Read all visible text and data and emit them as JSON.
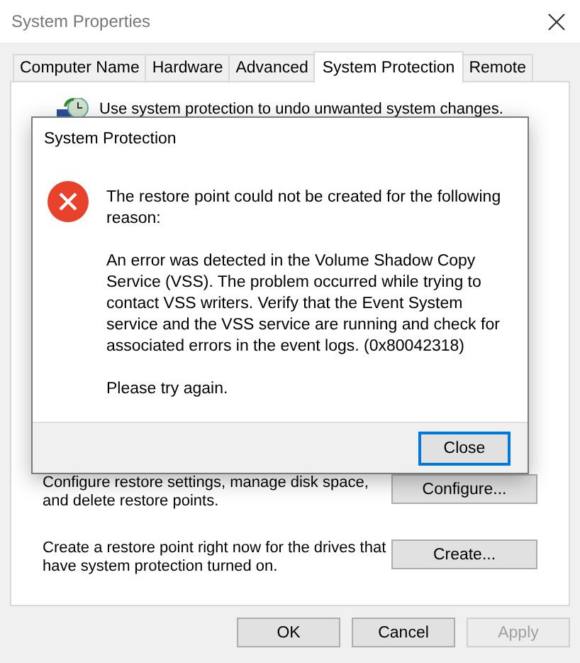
{
  "window": {
    "title": "System Properties"
  },
  "tabs": [
    {
      "label": "Computer Name",
      "selected": false
    },
    {
      "label": "Hardware",
      "selected": false
    },
    {
      "label": "Advanced",
      "selected": false
    },
    {
      "label": "System Protection",
      "selected": true
    },
    {
      "label": "Remote",
      "selected": false
    }
  ],
  "panel": {
    "intro": "Use system protection to undo unwanted system changes.",
    "actions": [
      {
        "description": "Configure restore settings, manage disk space, and delete restore points.",
        "button": "Configure..."
      },
      {
        "description": "Create a restore point right now for the drives that have system protection turned on.",
        "button": "Create..."
      }
    ]
  },
  "buttons": [
    {
      "label": "OK",
      "disabled": false
    },
    {
      "label": "Cancel",
      "disabled": false
    },
    {
      "label": "Apply",
      "disabled": true
    }
  ],
  "dialog": {
    "title": "System Protection",
    "message": "The restore point could not be created for the following reason:",
    "details": "An error was detected in the Volume Shadow Copy Service (VSS). The problem occurred while trying to contact VSS writers. Verify that the Event System service and the VSS service are running and check for associated errors in the event logs. (0x80042318)",
    "retry": "Please try again.",
    "button": {
      "label": "Close",
      "focused": true
    }
  }
}
